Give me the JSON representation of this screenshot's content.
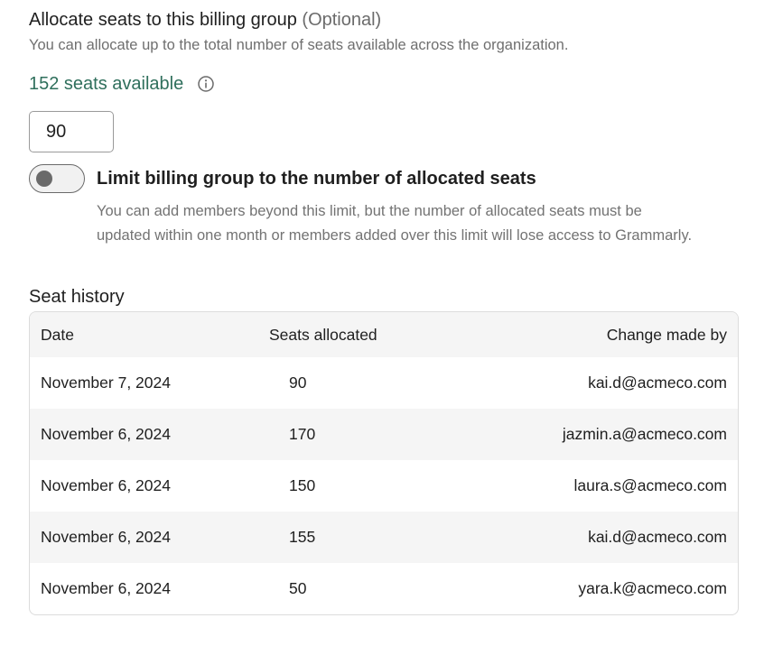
{
  "allocate": {
    "title": "Allocate seats to this billing group",
    "optional_label": "(Optional)",
    "subtitle": "You can allocate up to the total number of seats available across the organization.",
    "available_text": "152 seats available",
    "info_icon": "info-icon",
    "seat_value": "90"
  },
  "limit": {
    "label": "Limit billing group to the number of allocated seats",
    "enabled": false,
    "description": "You can add members beyond this limit, but the number of allocated seats must be updated within one month or members added over this limit will lose access to Grammarly."
  },
  "history": {
    "title": "Seat history",
    "columns": {
      "date": "Date",
      "seats": "Seats allocated",
      "changed_by": "Change made by"
    },
    "rows": [
      {
        "date": "November 7, 2024",
        "seats": "90",
        "changed_by": "kai.d@acmeco.com"
      },
      {
        "date": "November 6, 2024",
        "seats": "170",
        "changed_by": "jazmin.a@acmeco.com"
      },
      {
        "date": "November 6, 2024",
        "seats": "150",
        "changed_by": "laura.s@acmeco.com"
      },
      {
        "date": "November 6, 2024",
        "seats": "155",
        "changed_by": "kai.d@acmeco.com"
      },
      {
        "date": "November 6, 2024",
        "seats": "50",
        "changed_by": "yara.k@acmeco.com"
      }
    ]
  },
  "colors": {
    "available_accent": "#2f6f5c",
    "muted_text": "#6f6f6f",
    "row_alt_bg": "#f5f5f5"
  }
}
